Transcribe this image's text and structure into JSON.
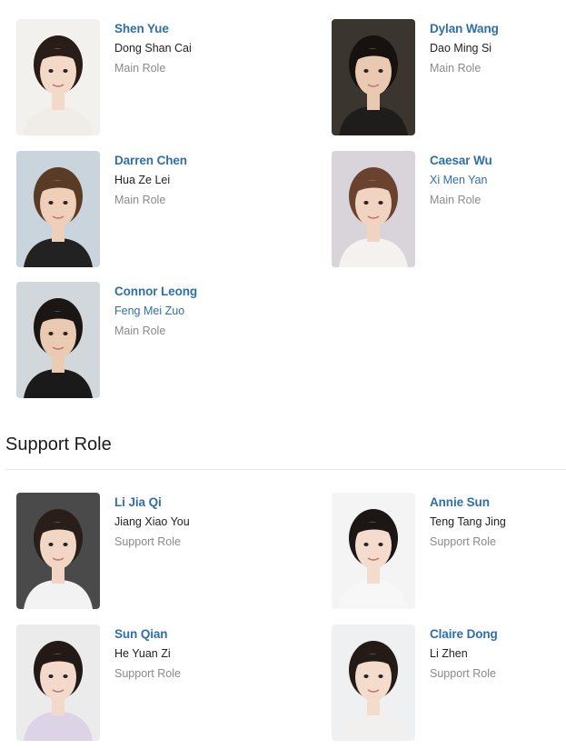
{
  "main_cast": [
    {
      "name": "Shen Yue",
      "character": "Dong Shan Cai",
      "character_linked": false,
      "role": "Main Role",
      "photo": {
        "bg": "#f3f1ee",
        "skin": "#f3d9c8",
        "hair": "#2a1d18",
        "shirt": "#f0ece8"
      }
    },
    {
      "name": "Dylan Wang",
      "character": "Dao Ming Si",
      "character_linked": false,
      "role": "Main Role",
      "photo": {
        "bg": "#3b3530",
        "skin": "#e9c9b2",
        "hair": "#17120f",
        "shirt": "#1f1d1c"
      }
    },
    {
      "name": "Darren Chen",
      "character": "Hua Ze Lei",
      "character_linked": false,
      "role": "Main Role",
      "photo": {
        "bg": "#c9d4dc",
        "skin": "#efcfb9",
        "hair": "#5a3b26",
        "shirt": "#222222"
      }
    },
    {
      "name": "Caesar Wu",
      "character": "Xi Men Yan",
      "character_linked": true,
      "role": "Main Role",
      "photo": {
        "bg": "#d9d4da",
        "skin": "#f1d3c2",
        "hair": "#6a4330",
        "shirt": "#f4f1ee"
      }
    },
    {
      "name": "Connor Leong",
      "character": "Feng Mei Zuo",
      "character_linked": true,
      "role": "Main Role",
      "photo": {
        "bg": "#d2d7dc",
        "skin": "#ebcab4",
        "hair": "#1b1613",
        "shirt": "#1a1a1a"
      }
    }
  ],
  "support_section": {
    "title": "Support Role"
  },
  "support_cast": [
    {
      "name": "Li Jia Qi",
      "character": "Jiang Xiao You",
      "character_linked": false,
      "role": "Support Role",
      "photo": {
        "bg": "#4a4a4a",
        "skin": "#f1d6c6",
        "hair": "#2a1e1a",
        "shirt": "#f2f2f2"
      }
    },
    {
      "name": "Annie Sun",
      "character": "Teng Tang Jing",
      "character_linked": false,
      "role": "Support Role",
      "photo": {
        "bg": "#f4f4f4",
        "skin": "#f3dccd",
        "hair": "#1c1614",
        "shirt": "#f7f7f7"
      }
    },
    {
      "name": "Sun Qian",
      "character": "He Yuan Zi",
      "character_linked": false,
      "role": "Support Role",
      "photo": {
        "bg": "#ecebec",
        "skin": "#f2d9cb",
        "hair": "#231a17",
        "shirt": "#dcd3e6"
      }
    },
    {
      "name": "Claire Dong",
      "character": "Li Zhen",
      "character_linked": false,
      "role": "Support Role",
      "photo": {
        "bg": "#eef0f2",
        "skin": "#f3dccc",
        "hair": "#241a16",
        "shirt": "#f2f0ef"
      }
    }
  ]
}
